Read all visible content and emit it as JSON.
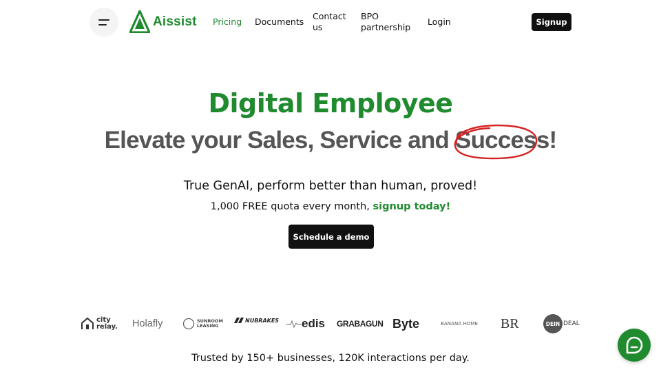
{
  "header": {
    "brand": "Aissist",
    "nav": [
      {
        "label": "Pricing"
      },
      {
        "label": "Documents"
      },
      {
        "label": "Contact\nus"
      },
      {
        "label": "BPO\npartnership"
      },
      {
        "label": "Login"
      }
    ],
    "signup_label": "Signup"
  },
  "hero": {
    "title": "Digital Employee",
    "subtitle_prefix": "Elevate your Sales, Service and ",
    "subtitle_highlight": "Success",
    "subtitle_suffix": "!",
    "tagline": "True GenAI, perform better than human, proved!",
    "quota_text": "1,000 FREE quota every month, ",
    "quota_link": "signup today!",
    "demo_label": "Schedule a demo"
  },
  "logos": {
    "city_relay": [
      "city",
      "relay."
    ],
    "holafly": "Holafly",
    "sunroom": [
      "SUNROOM",
      "LEASING"
    ],
    "nubrakes": "NUBRAKES",
    "edis": "edis",
    "grabagun": "GRABAGUN",
    "byte": "Byte",
    "banana_home": "BANANA HOME",
    "br": "BR",
    "dein": "DEIN",
    "deal": "DEAL"
  },
  "trusted_text": "Trusted by 150+ businesses, 120K interactions per day.",
  "colors": {
    "brand_green": "#1f8a2e",
    "button_dark": "#111111",
    "highlight_circle": "#d62222"
  },
  "icons": {
    "menu": "menu-icon",
    "chat": "chat-icon",
    "logo": "triangle-logo-icon"
  }
}
